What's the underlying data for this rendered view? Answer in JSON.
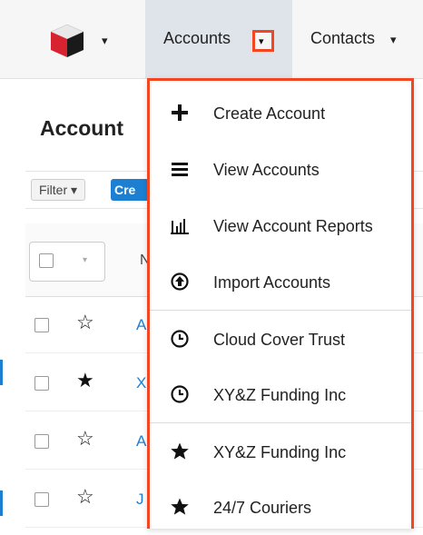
{
  "nav": {
    "tabs": [
      {
        "label": "Accounts",
        "active": true
      },
      {
        "label": "Contacts",
        "active": false
      }
    ],
    "caret_glyph": "▾"
  },
  "page": {
    "title": "Account",
    "filter_label": "Filter ▾",
    "create_label": "Cre",
    "header": {
      "name_col": "N"
    }
  },
  "rows": [
    {
      "starred": false,
      "name_fragment": "A"
    },
    {
      "starred": true,
      "name_fragment": "X"
    },
    {
      "starred": false,
      "name_fragment": "A"
    },
    {
      "starred": false,
      "name_fragment": "J"
    }
  ],
  "dropdown": {
    "items": [
      {
        "label": "Create Account",
        "icon": "plus-icon"
      },
      {
        "label": "View Accounts",
        "icon": "list-icon"
      },
      {
        "label": "View Account Reports",
        "icon": "bar-chart-icon"
      },
      {
        "label": "Import Accounts",
        "icon": "upload-circle-icon"
      },
      {
        "label": "Cloud Cover Trust",
        "icon": "clock-icon"
      },
      {
        "label": "XY&Z Funding Inc",
        "icon": "clock-icon"
      },
      {
        "label": "XY&Z Funding Inc",
        "icon": "star-icon"
      },
      {
        "label": "24/7 Couriers",
        "icon": "star-icon"
      }
    ]
  },
  "colors": {
    "highlight": "#f24722",
    "link": "#1d7fd2",
    "active_tab_bg": "#dfe3ea"
  }
}
